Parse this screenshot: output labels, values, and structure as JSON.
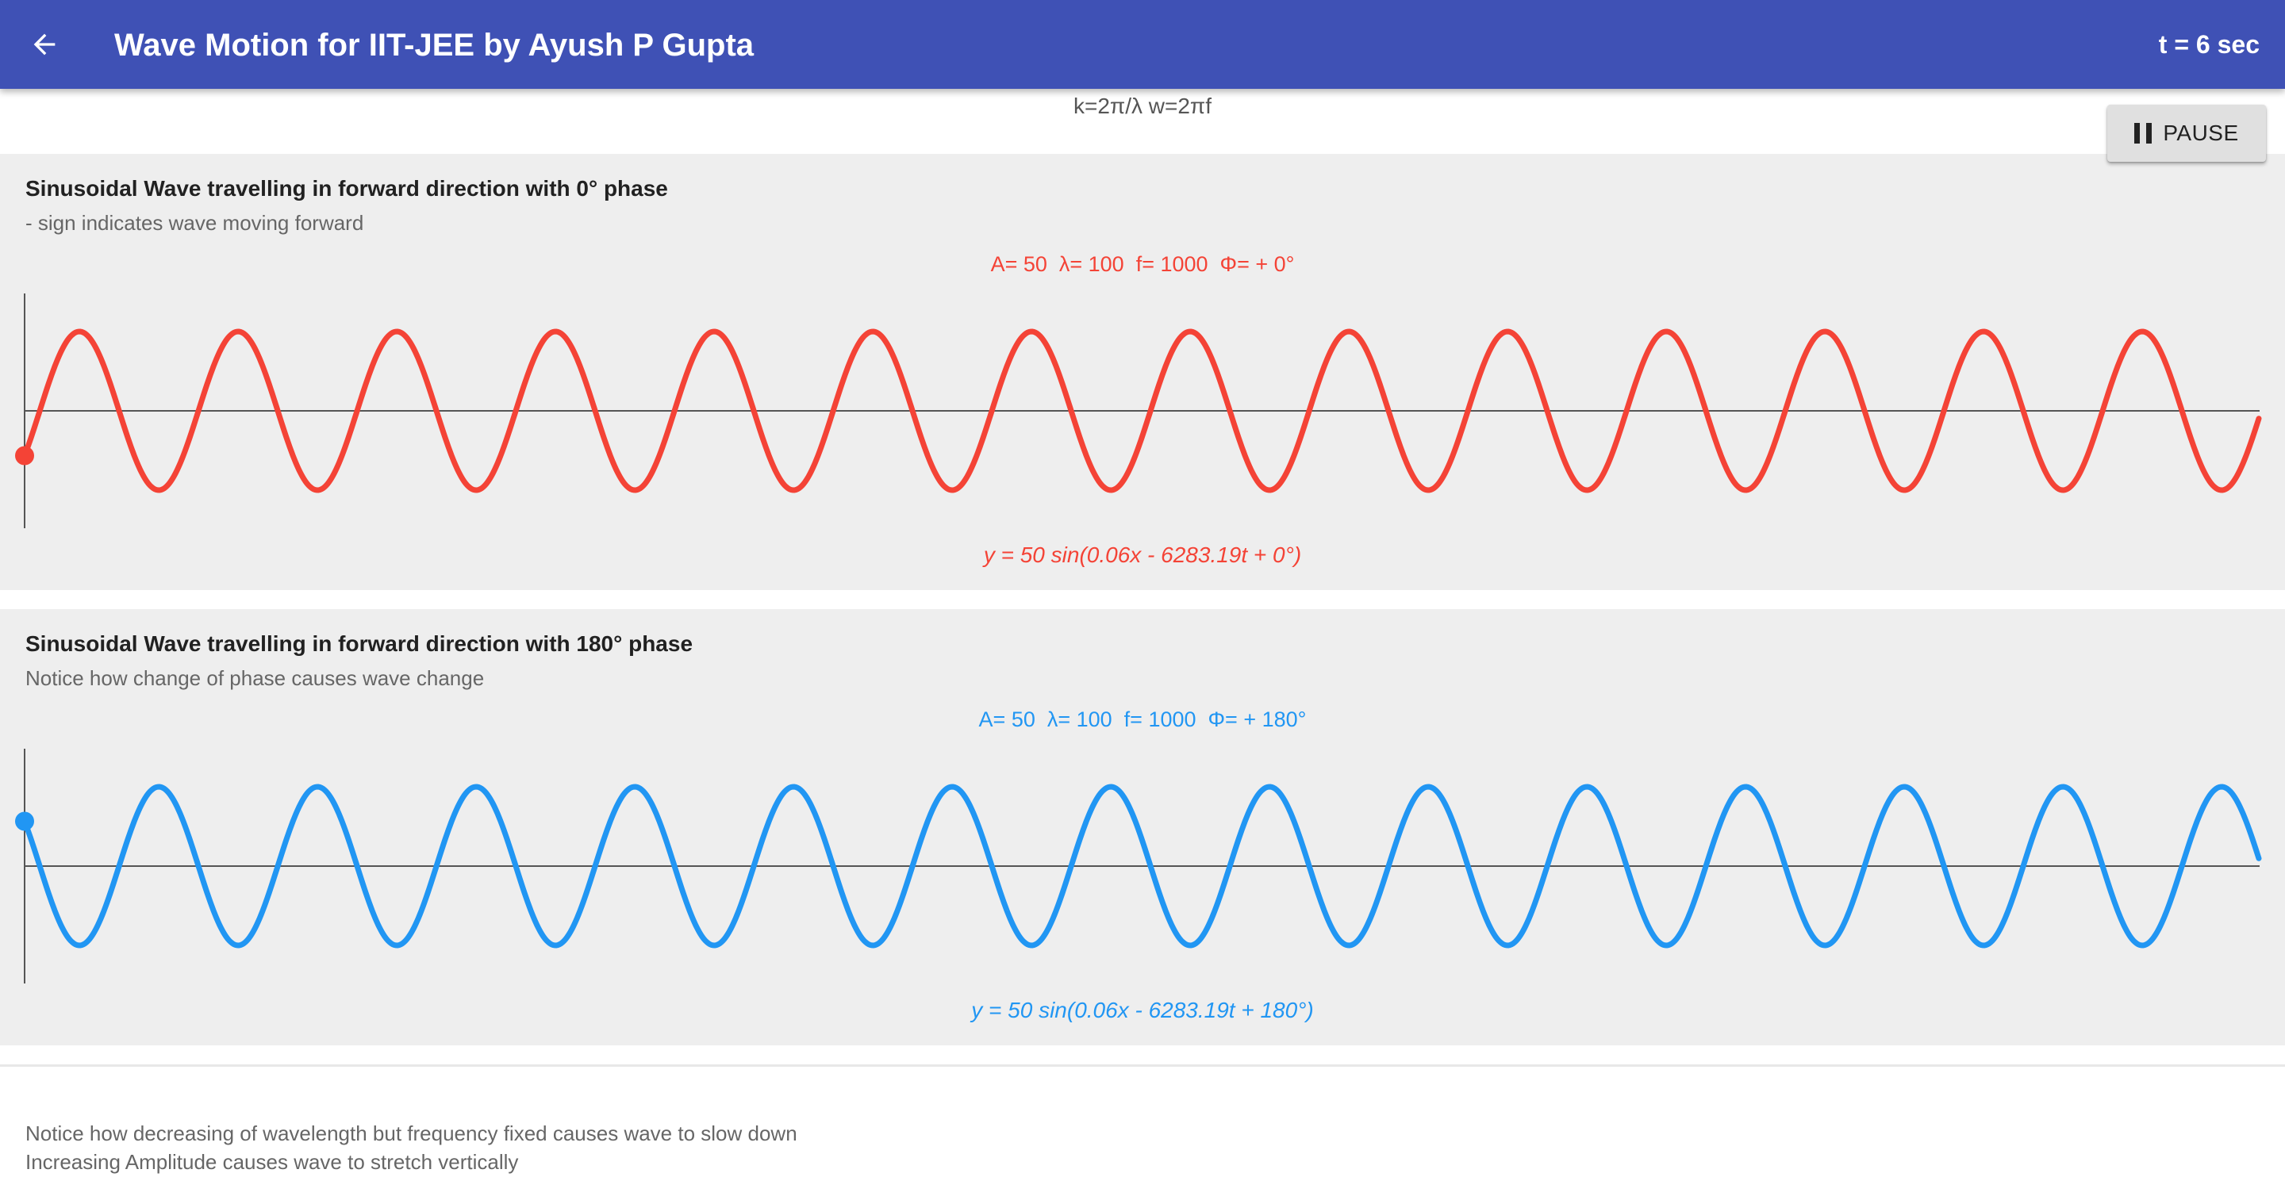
{
  "app_bar": {
    "title": "Wave Motion for IIT-JEE by Ayush P Gupta",
    "timer": "t = 6 sec",
    "back_icon": "arrow-back-icon",
    "background_color": "#3F51B5"
  },
  "header": {
    "formulas": "k=2π/λ  w=2πf"
  },
  "pause_button": {
    "label": "PAUSE",
    "icon": "pause-icon"
  },
  "waves": [
    {
      "title": "Sinusoidal Wave travelling in forward direction with 0° phase",
      "subtitle": "- sign indicates wave moving forward",
      "params": "A= 50  λ= 100  f= 1000  Φ= + 0°",
      "equation": "y = 50 sin(0.06x - 6283.19t + 0°)",
      "color": "#F44336",
      "amplitude": 50,
      "wavelength": 100,
      "frequency": 1000,
      "phase_deg": 0
    },
    {
      "title": "Sinusoidal Wave travelling in forward direction with 180° phase",
      "subtitle": "Notice how change of phase causes wave change",
      "params": "A= 50  λ= 100  f= 1000  Φ= + 180°",
      "equation": "y = 50 sin(0.06x - 6283.19t + 180°)",
      "color": "#2196F3",
      "amplitude": 50,
      "wavelength": 100,
      "frequency": 1000,
      "phase_deg": 180
    }
  ],
  "notes": [
    "Notice how decreasing of wavelength but frequency fixed causes wave to slow down",
    "Increasing Amplitude causes wave to stretch vertically"
  ]
}
